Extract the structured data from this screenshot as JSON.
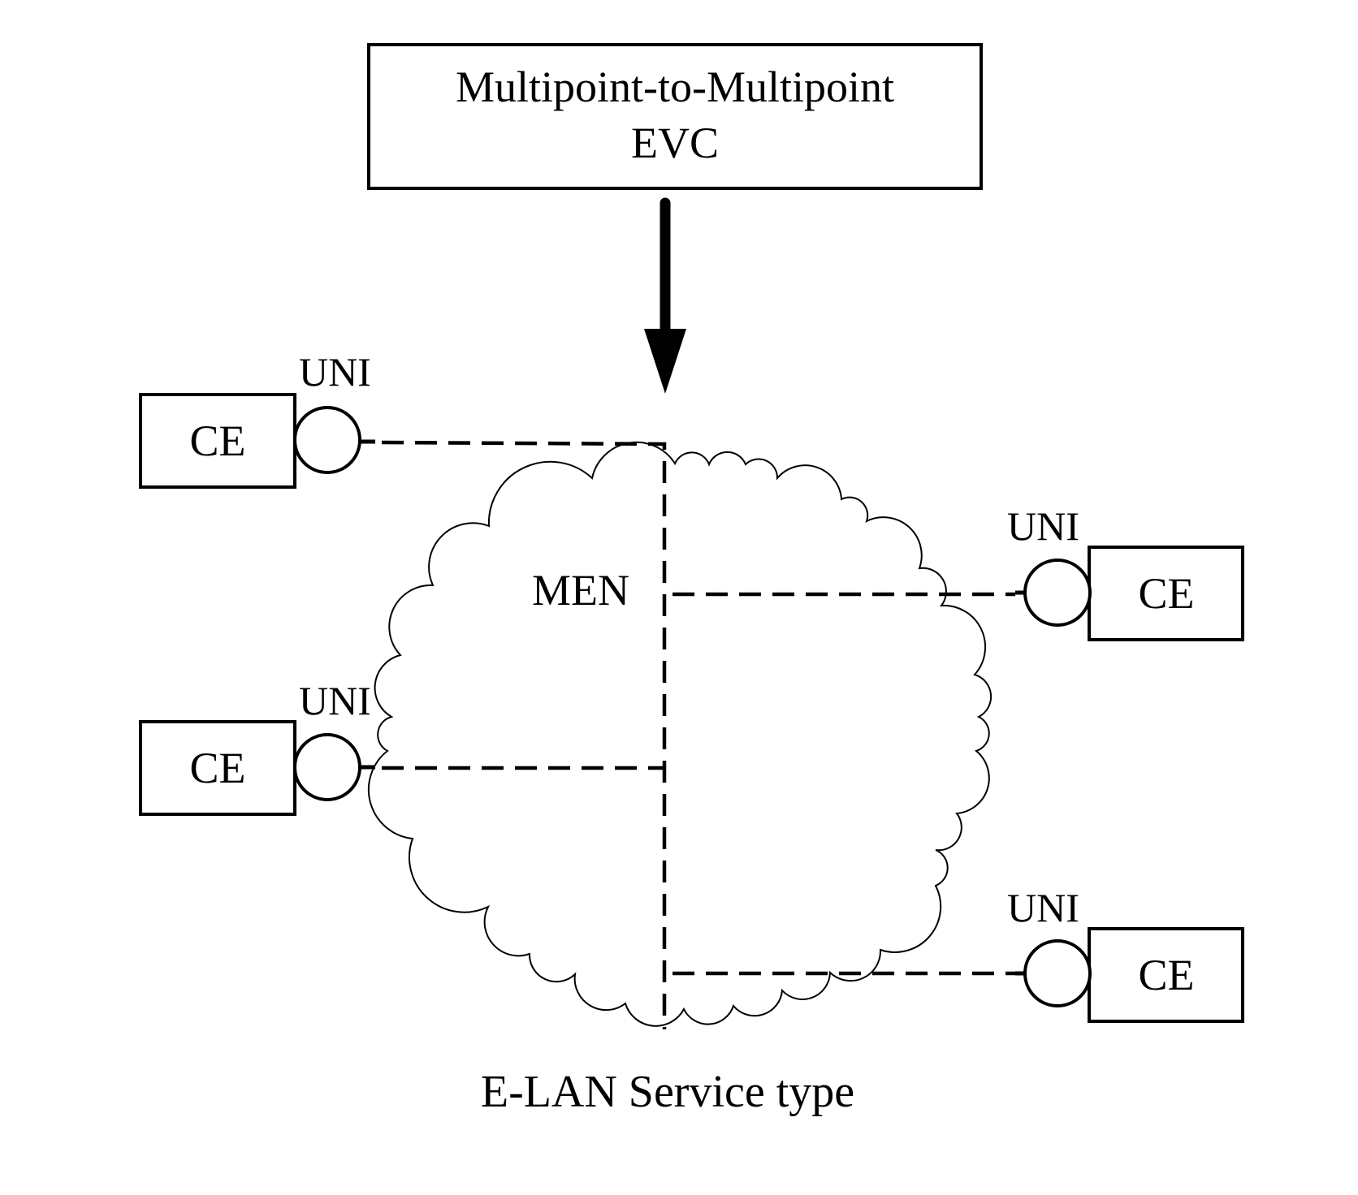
{
  "diagram": {
    "evc_box": {
      "line1": "Multipoint-to-Multipoint",
      "line2": "EVC"
    },
    "network_label": "MEN",
    "caption": "E-LAN Service type",
    "sites": [
      {
        "position": "left-top",
        "ce_label": "CE",
        "uni_label": "UNI"
      },
      {
        "position": "left-middle",
        "ce_label": "CE",
        "uni_label": "UNI"
      },
      {
        "position": "right-top",
        "ce_label": "CE",
        "uni_label": "UNI"
      },
      {
        "position": "right-bottom",
        "ce_label": "CE",
        "uni_label": "UNI"
      }
    ],
    "colors": {
      "stroke": "#000000",
      "background": "#ffffff"
    }
  }
}
